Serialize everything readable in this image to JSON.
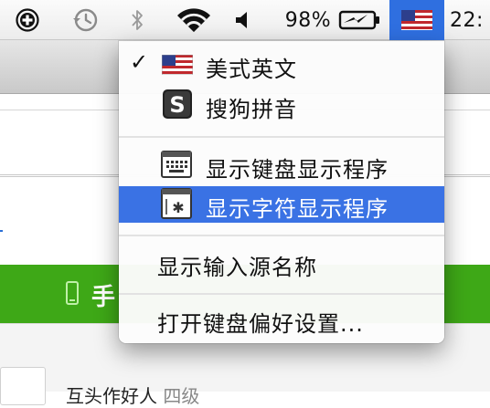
{
  "menubar": {
    "icons": [
      "add-circle-icon",
      "time-machine-icon",
      "bluetooth-icon",
      "wifi-icon",
      "volume-icon",
      "battery-charging-icon",
      "input-source-flag-icon"
    ],
    "battery_percent": "98%",
    "clock": "22:"
  },
  "input_menu": {
    "items": [
      {
        "label": "美式英文",
        "icon": "us-flag-icon",
        "checked": true
      },
      {
        "label": "搜狗拼音",
        "icon": "sogou-s-icon",
        "checked": false
      },
      {
        "label": "显示键盘显示程序",
        "icon": "keyboard-viewer-icon"
      },
      {
        "label": "显示字符显示程序",
        "icon": "character-viewer-icon",
        "highlighted": true
      },
      {
        "label": "显示输入源名称"
      },
      {
        "label": "打开键盘偏好设置..."
      }
    ]
  },
  "background": {
    "green_bar_text": "手",
    "lower_text": "互头作好人",
    "lower_text_muted": "四级"
  },
  "colors": {
    "highlight": "#3a72e4",
    "green_bar": "#3ea817",
    "menubar_flag_bg": "#2f6fe0"
  }
}
